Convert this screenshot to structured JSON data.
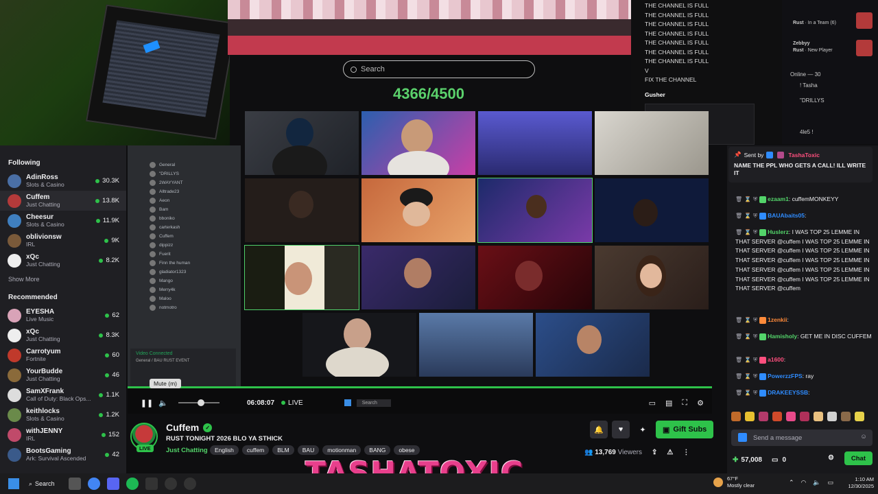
{
  "search": {
    "placeholder": "Search"
  },
  "counter": "4366/4500",
  "overlay": {
    "messages": [
      "THE CHANNEL IS FULL",
      "THE CHANNEL IS FULL",
      "THE CHANNEL IS FULL",
      "THE CHANNEL IS FULL",
      "THE CHANNEL IS FULL",
      "THE CHANNEL IS FULL",
      "THE CHANNEL IS FULL",
      "V",
      "FIX THE CHANNEL"
    ],
    "gusher": "Gusher",
    "rust_rows": [
      {
        "name": "Rust",
        "status": "In a Team (6)"
      },
      {
        "name": "Zebbyy",
        "status": ""
      },
      {
        "name": "Rust",
        "status": "New Player"
      }
    ],
    "online": "Online — 30",
    "users": [
      "! Tasha",
      "\"DRILLYS",
      "4le5 !"
    ]
  },
  "sidebar": {
    "following_title": "Following",
    "following": [
      {
        "name": "AdinRoss",
        "game": "Slots & Casino",
        "viewers": "30.3K",
        "color": "#4a6fa5"
      },
      {
        "name": "Cuffem",
        "game": "Just Chatting",
        "viewers": "13.8K",
        "color": "#b33a3a"
      },
      {
        "name": "Cheesur",
        "game": "Slots & Casino",
        "viewers": "11.9K",
        "color": "#3f7fbf"
      },
      {
        "name": "oblivionsw",
        "game": "IRL",
        "viewers": "9K",
        "color": "#7a5a3a"
      },
      {
        "name": "xQc",
        "game": "Just Chatting",
        "viewers": "8.2K",
        "color": "#eee"
      }
    ],
    "show_more": "Show More",
    "recommended_title": "Recommended",
    "recommended": [
      {
        "name": "EYESHA",
        "game": "Live Music",
        "viewers": "62",
        "color": "#d9a3b8"
      },
      {
        "name": "xQc",
        "game": "Just Chatting",
        "viewers": "8.3K",
        "color": "#eee"
      },
      {
        "name": "Carrotyum",
        "game": "Fortnite",
        "viewers": "60",
        "color": "#c0392b"
      },
      {
        "name": "YourBudde",
        "game": "Just Chatting",
        "viewers": "46",
        "color": "#8a6a3a"
      },
      {
        "name": "SamXFrank",
        "game": "Call of Duty: Black Ops...",
        "viewers": "1.1K",
        "color": "#ddd"
      },
      {
        "name": "keithlocks",
        "game": "Slots & Casino",
        "viewers": "1.2K",
        "color": "#6a8a4a"
      },
      {
        "name": "withJENNY",
        "game": "IRL",
        "viewers": "152",
        "color": "#c04a6a"
      },
      {
        "name": "BootsGaming",
        "game": "Ark: Survival Ascended",
        "viewers": "42",
        "color": "#3a5a8a"
      }
    ]
  },
  "discord": {
    "members": [
      "General",
      "\"DRILLYS",
      "2WAYYANT",
      "Alltrade23",
      "Aeon",
      "Bam",
      "bboniko",
      "carterkash",
      "Cuffem",
      "dippizz",
      "Fuerit",
      "Finn the human",
      "gladiator1323",
      "Mango",
      "Merry4k",
      "Maloo",
      "notmotro"
    ],
    "video_connected": "Video Connected",
    "channel": "General / BAU RUST EVENT"
  },
  "player": {
    "time": "06:08:07",
    "live": "LIVE",
    "mute_tooltip": "Mute (m)",
    "taskbar_search": "Search"
  },
  "stream": {
    "name": "Cuffem",
    "title": "RUST TONIGHT 2026 BLO YA STHICK",
    "live_badge": "LIVE",
    "category": "Just Chatting",
    "tags": [
      "English",
      "cuffem",
      "BLM",
      "BAU",
      "motionman",
      "BANG",
      "obese"
    ],
    "gift_label": "Gift Subs",
    "viewers": "13,769",
    "viewers_label": "Viewers",
    "logo_text": "TASHATOXIC"
  },
  "chat": {
    "pinned_by_label": "Sent by",
    "pinned_by": "TashaToxic",
    "pinned_msg": "NAME THE PPL WHO GETS A CALL! ILL WRITE IT",
    "messages": [
      {
        "user": "ezaam1",
        "color": "#53d46a",
        "text": "cuffemMONKEYY"
      },
      {
        "user": "BAUAbaits05",
        "color": "#2f8cff",
        "text": ""
      },
      {
        "user": "Huslerz",
        "color": "#53d46a",
        "text": "I WAS TOP 25 LEMME IN THAT SERVER @cuffem I WAS TOP 25 LEMME IN THAT SERVER @cuffem I WAS TOP 25 LEMME IN THAT SERVER @cuffem I WAS TOP 25 LEMME IN THAT SERVER @cuffem I WAS TOP 25 LEMME IN THAT SERVER @cuffem I WAS TOP 25 LEMME IN THAT SERVER @cuffem"
      },
      {
        "user": "1zenkii",
        "color": "#ff8a3a",
        "text": ""
      },
      {
        "user": "Hamisholy",
        "color": "#53d46a",
        "text": "GET ME IN DISC CUFFEM"
      },
      {
        "user": "a1600",
        "color": "#ff4f7e",
        "text": ""
      },
      {
        "user": "PowerzzFPS",
        "color": "#2f8cff",
        "text": "ray"
      },
      {
        "user": "DRAKEEYSSB",
        "color": "#2f8cff",
        "text": ""
      }
    ],
    "input_placeholder": "Send a message",
    "points": "57,008",
    "drops": "0",
    "chat_button": "Chat"
  },
  "taskbar": {
    "search": "Search",
    "temp": "67°F",
    "weather": "Mostly clear",
    "time": "1:10 AM",
    "date": "12/30/2025"
  }
}
